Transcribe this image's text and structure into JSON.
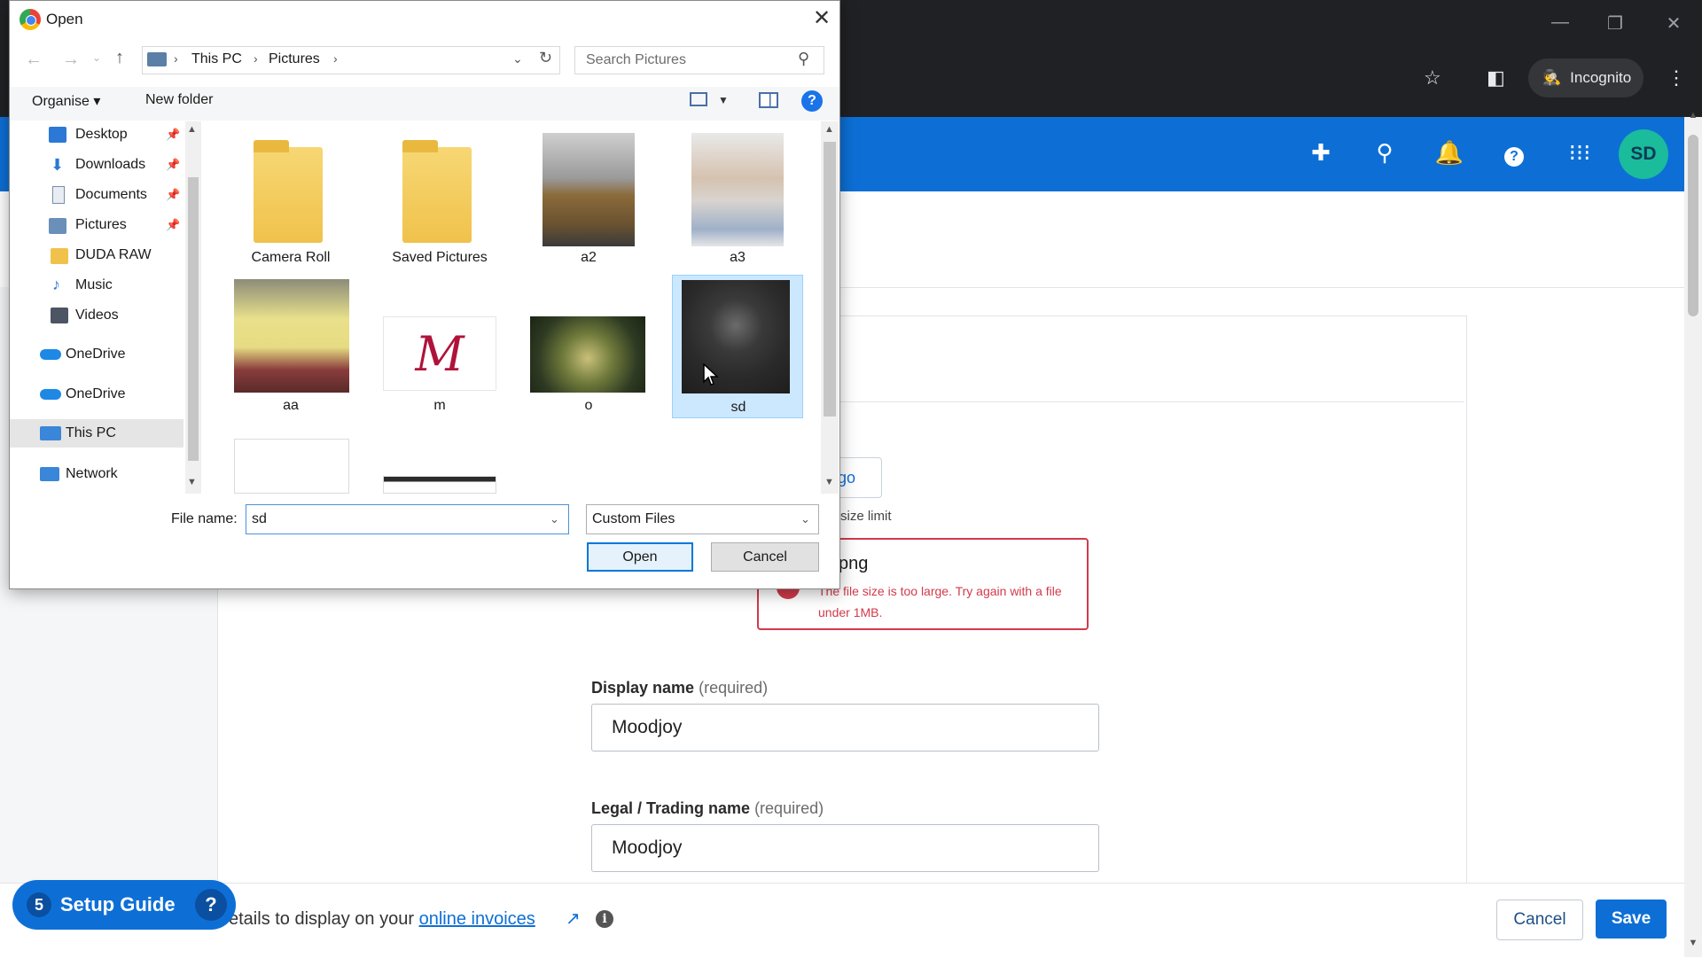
{
  "browser": {
    "incognito_label": "Incognito",
    "window_controls": [
      "minimize-icon",
      "restore-icon",
      "close-icon"
    ]
  },
  "header": {
    "icons": [
      "plus-icon",
      "search-icon",
      "bell-icon",
      "help-icon",
      "apps-grid-icon"
    ],
    "avatar_initials": "SD",
    "accent_color": "#0d6fd6"
  },
  "form": {
    "logo_button_label": "ogo",
    "size_limit_text": "size limit",
    "error": {
      "title": "png",
      "message": "The file size is too large. Try again with a file under 1MB."
    },
    "display_name": {
      "label": "Display name",
      "required": "(required)",
      "value": "Moodjoy"
    },
    "legal_name": {
      "label": "Legal / Trading name",
      "required": "(required)",
      "value": "Moodjoy"
    }
  },
  "footer": {
    "text_prefix": "etails to display on your",
    "link_text": "online invoices",
    "cancel_label": "Cancel",
    "save_label": "Save"
  },
  "setup_guide": {
    "count": "5",
    "label": "Setup Guide"
  },
  "dialog": {
    "title": "Open",
    "address": {
      "crumbs": [
        "This PC",
        "Pictures"
      ]
    },
    "search_placeholder": "Search Pictures",
    "toolbar": {
      "organise": "Organise ▾",
      "new_folder": "New folder"
    },
    "nav_items": [
      {
        "label": "Desktop",
        "pinned": true
      },
      {
        "label": "Downloads",
        "pinned": true
      },
      {
        "label": "Documents",
        "pinned": true
      },
      {
        "label": "Pictures",
        "pinned": true
      },
      {
        "label": "DUDA RAW",
        "pinned": false
      },
      {
        "label": "Music",
        "pinned": false
      },
      {
        "label": "Videos",
        "pinned": false
      },
      {
        "label": "OneDrive",
        "pinned": false
      },
      {
        "label": "OneDrive",
        "pinned": false
      },
      {
        "label": "This PC",
        "pinned": false
      },
      {
        "label": "Network",
        "pinned": false
      }
    ],
    "files": [
      {
        "name": "Camera Roll",
        "kind": "folder"
      },
      {
        "name": "Saved Pictures",
        "kind": "folder"
      },
      {
        "name": "a2",
        "kind": "image"
      },
      {
        "name": "a3",
        "kind": "image"
      },
      {
        "name": "aa",
        "kind": "image"
      },
      {
        "name": "m",
        "kind": "image"
      },
      {
        "name": "o",
        "kind": "image"
      },
      {
        "name": "sd",
        "kind": "image",
        "selected": true
      }
    ],
    "file_name_label": "File name:",
    "file_name_value": "sd",
    "file_type_value": "Custom Files",
    "open_label": "Open",
    "cancel_label": "Cancel"
  }
}
